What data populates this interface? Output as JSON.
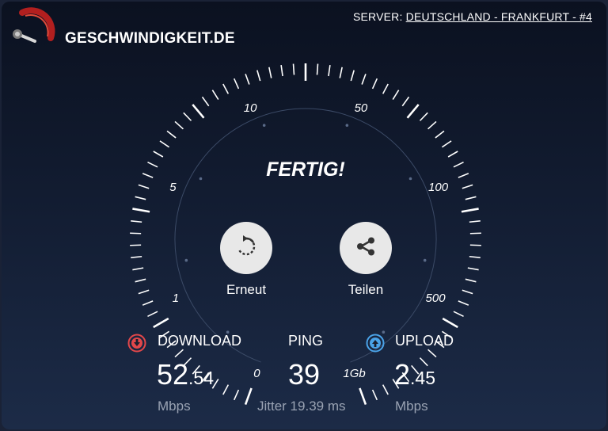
{
  "header": {
    "brand": "GESCHWINDIGKEIT.DE",
    "server_label": "SERVER:",
    "server_value": "DEUTSCHLAND - FRANKFURT - #4",
    "logo_icon": "speedometer-logo-icon"
  },
  "gauge": {
    "status": "FERTIG!",
    "scale_labels": [
      "0",
      "1",
      "5",
      "10",
      "50",
      "100",
      "500",
      "1Gb"
    ],
    "fill_fraction": 0
  },
  "actions": {
    "retry_label": "Erneut",
    "share_label": "Teilen",
    "retry_icon": "restart-icon",
    "share_icon": "share-icon"
  },
  "results": {
    "download": {
      "title": "DOWNLOAD",
      "int": "52",
      "dec": ".54",
      "unit": "Mbps",
      "icon": "download-arrow-icon"
    },
    "ping": {
      "title": "PING",
      "value": "39",
      "sub": "Jitter 19.39 ms"
    },
    "upload": {
      "title": "UPLOAD",
      "int": "2",
      "dec": ".45",
      "unit": "Mbps",
      "icon": "upload-arrow-icon"
    }
  },
  "colors": {
    "download": "#e2474a",
    "upload": "#4aa3e8",
    "logo_red": "#b21f1f",
    "muted": "#9aa3b3"
  }
}
